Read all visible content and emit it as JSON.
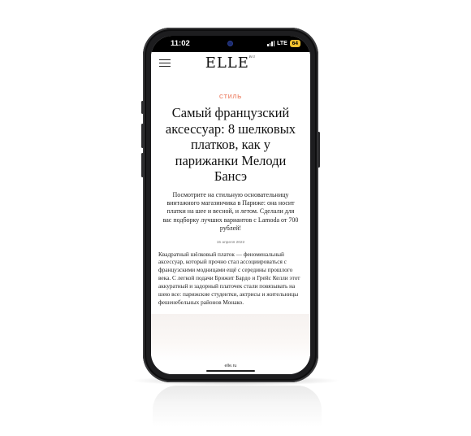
{
  "status_bar": {
    "time": "11:02",
    "network": "LTE",
    "battery": "64"
  },
  "header": {
    "logo": "ELLE",
    "logo_sub": "RU"
  },
  "article": {
    "category": "СТИЛЬ",
    "title": "Самый французский аксессуар: 8 шелковых платков, как у парижанки Мелоди Бансэ",
    "lead": "Посмотрите на стильную основательницу винтажного магазинчика в Париже: она носит платки на шее и весной, и летом. Сделали для вас подборку лучших вариантов с Lamoda от 700 рублей!",
    "date": "15 апреля 2022",
    "body": "Квадратный шёлковый платок — феноменальный аксессуар, который прочно стал ассоциироваться с французскими модницами ещё с середины прошлого века. С легкой подачи Брижит Бардо и Грейс Келли этот аккуратный и задорный платочек стали повязывать на шею все: парижские студентки, актрисы и жительницы фешенебельных районов Монако."
  },
  "browser": {
    "url": "elle.ru"
  },
  "colors": {
    "accent": "#f0957e",
    "battery": "#f2c230",
    "phone_body": "#1d1d1f"
  },
  "icons": [
    "hamburger-menu-icon",
    "signal-icon",
    "camera-icon"
  ]
}
